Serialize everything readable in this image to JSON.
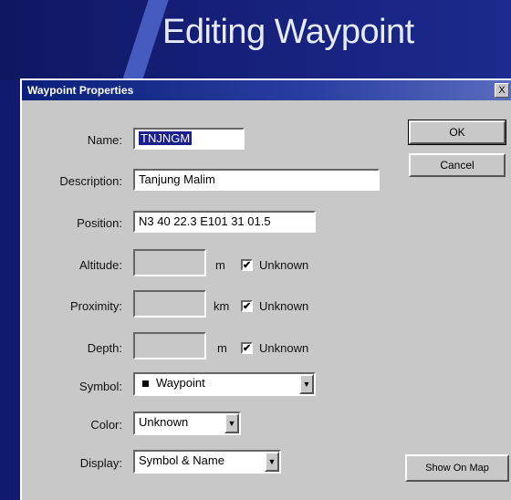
{
  "banner": {
    "title": "Editing Waypoint"
  },
  "dialog": {
    "title": "Waypoint Properties",
    "close_label": "X",
    "fields": {
      "name": {
        "label": "Name:",
        "value": "TNJNGM"
      },
      "description": {
        "label": "Description:",
        "value": "Tanjung Malim"
      },
      "position": {
        "label": "Position:",
        "value": "N3 40 22.3 E101 31 01.5"
      },
      "altitude": {
        "label": "Altitude:",
        "value": "",
        "unit": "m",
        "unknown_label": "Unknown",
        "unknown_checked": true
      },
      "proximity": {
        "label": "Proximity:",
        "value": "",
        "unit": "km",
        "unknown_label": "Unknown",
        "unknown_checked": true
      },
      "depth": {
        "label": "Depth:",
        "value": "",
        "unit": "m",
        "unknown_label": "Unknown",
        "unknown_checked": true
      },
      "symbol": {
        "label": "Symbol:",
        "value": "Waypoint"
      },
      "color": {
        "label": "Color:",
        "value": "Unknown"
      },
      "display": {
        "label": "Display:",
        "value": "Symbol & Name"
      }
    },
    "buttons": {
      "ok": "OK",
      "cancel": "Cancel",
      "show_on_map": "Show On Map"
    },
    "check_mark": "✔",
    "dropdown_arrow": "▼"
  }
}
